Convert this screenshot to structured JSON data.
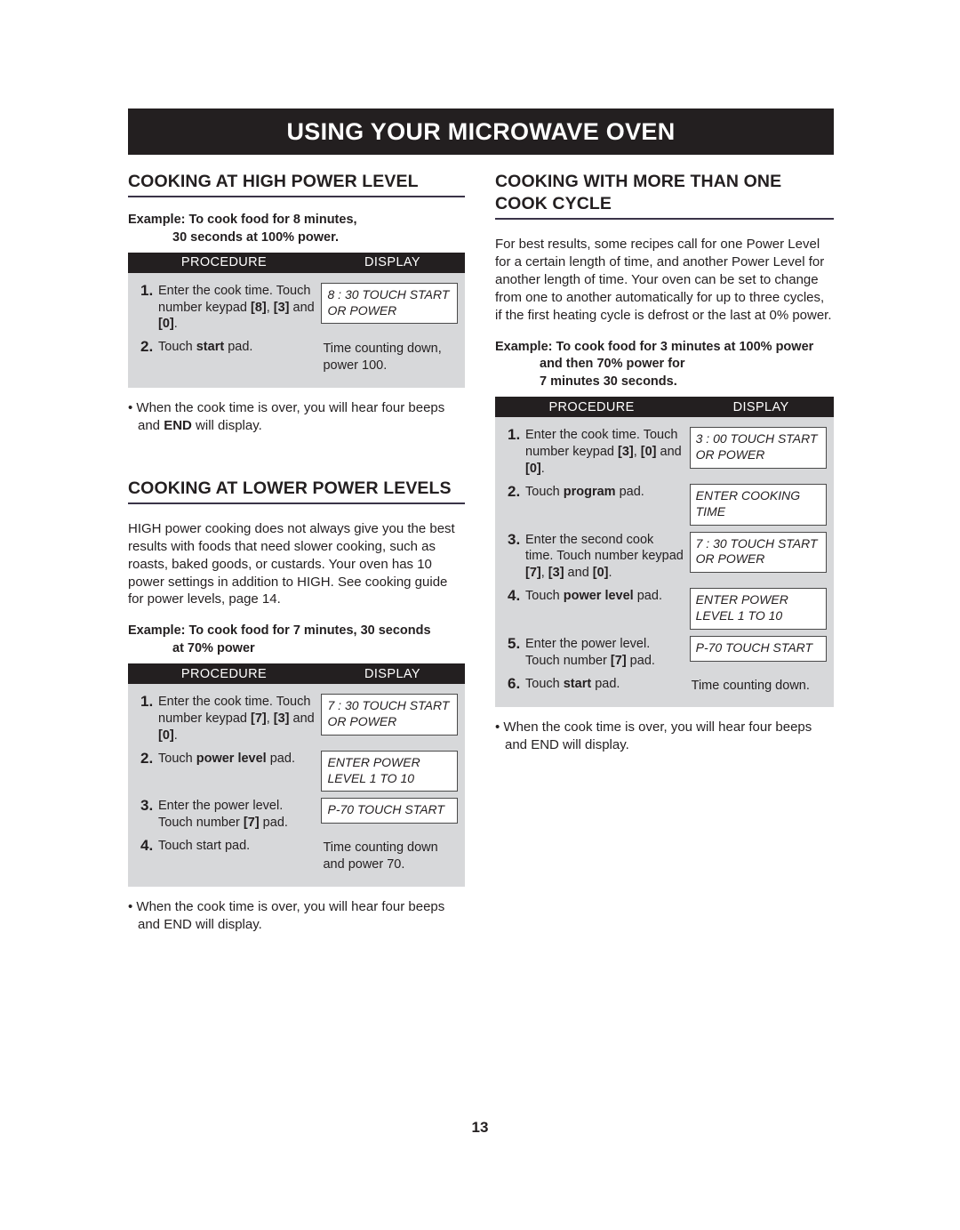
{
  "banner": {
    "title": "USING YOUR MICROWAVE OVEN"
  },
  "page_number": "13",
  "left_column": {
    "section1": {
      "heading": "COOKING AT HIGH POWER LEVEL",
      "example_line1": "Example: To cook food for 8 minutes,",
      "example_line2": "30 seconds at 100% power.",
      "table": {
        "header_procedure": "PROCEDURE",
        "header_display": "DISPLAY",
        "rows": [
          {
            "num": "1.",
            "procedure_parts": [
              {
                "text": "Enter the cook time. Touch number keypad ",
                "bold": false
              },
              {
                "text": "[8]",
                "bold": true
              },
              {
                "text": ", ",
                "bold": false
              },
              {
                "text": "[3]",
                "bold": true
              },
              {
                "text": " and ",
                "bold": false
              },
              {
                "text": "[0]",
                "bold": true
              },
              {
                "text": ".",
                "bold": false
              }
            ],
            "display": "8 : 30 TOUCH START OR POWER",
            "display_boxed": true
          },
          {
            "num": "2.",
            "procedure_parts": [
              {
                "text": "Touch ",
                "bold": false
              },
              {
                "text": "start",
                "bold": true
              },
              {
                "text": " pad.",
                "bold": false
              }
            ],
            "display": "Time counting down, power 100.",
            "display_boxed": false
          }
        ]
      },
      "note_parts": [
        {
          "text": "• When the cook time is over, you will hear four beeps and ",
          "bold": false
        },
        {
          "text": "END",
          "bold": true
        },
        {
          "text": " will display.",
          "bold": false
        }
      ]
    },
    "section2": {
      "heading": "COOKING AT LOWER POWER LEVELS",
      "body": "HIGH power cooking does not always give you the best results with foods that need slower cooking, such as roasts, baked goods, or custards. Your oven has 10 power settings in addition to HIGH. See cooking guide for power levels, page 14.",
      "example_line1": "Example: To cook food for 7 minutes, 30 seconds",
      "example_line2": "at 70% power",
      "table": {
        "header_procedure": "PROCEDURE",
        "header_display": "DISPLAY",
        "rows": [
          {
            "num": "1.",
            "procedure_parts": [
              {
                "text": "Enter the cook time. Touch number keypad ",
                "bold": false
              },
              {
                "text": "[7]",
                "bold": true
              },
              {
                "text": ", ",
                "bold": false
              },
              {
                "text": "[3]",
                "bold": true
              },
              {
                "text": " and ",
                "bold": false
              },
              {
                "text": "[0]",
                "bold": true
              },
              {
                "text": ".",
                "bold": false
              }
            ],
            "display": "7 : 30 TOUCH START OR POWER",
            "display_boxed": true
          },
          {
            "num": "2.",
            "procedure_parts": [
              {
                "text": "Touch ",
                "bold": false
              },
              {
                "text": "power level",
                "bold": true
              },
              {
                "text": " pad.",
                "bold": false
              }
            ],
            "display": "ENTER POWER LEVEL 1 TO 10",
            "display_boxed": true
          },
          {
            "num": "3.",
            "procedure_parts": [
              {
                "text": "Enter the power level. Touch number ",
                "bold": false
              },
              {
                "text": "[7]",
                "bold": true
              },
              {
                "text": " pad.",
                "bold": false
              }
            ],
            "display": "P-70 TOUCH START",
            "display_boxed": true
          },
          {
            "num": "4.",
            "procedure_parts": [
              {
                "text": "Touch start pad.",
                "bold": false
              }
            ],
            "display": "Time counting down and power 70.",
            "display_boxed": false
          }
        ]
      },
      "note_parts": [
        {
          "text": "• When the cook time is over, you will hear four beeps and END will display.",
          "bold": false
        }
      ]
    }
  },
  "right_column": {
    "section1": {
      "heading": "COOKING WITH MORE THAN ONE COOK CYCLE",
      "body": "For best results, some recipes call for one Power Level for a certain length of time, and another Power Level for another length of time. Your oven can be set to change from one to another automatically for up to three cycles, if the first heating cycle is defrost or the last at 0% power.",
      "example_line1": "Example: To cook food for 3 minutes at 100% power",
      "example_line2": "and then 70% power for",
      "example_line3": "7 minutes 30 seconds.",
      "table": {
        "header_procedure": "PROCEDURE",
        "header_display": "DISPLAY",
        "rows": [
          {
            "num": "1.",
            "procedure_parts": [
              {
                "text": "Enter the cook time. Touch number keypad ",
                "bold": false
              },
              {
                "text": "[3]",
                "bold": true
              },
              {
                "text": ", ",
                "bold": false
              },
              {
                "text": "[0]",
                "bold": true
              },
              {
                "text": " and ",
                "bold": false
              },
              {
                "text": "[0]",
                "bold": true
              },
              {
                "text": ".",
                "bold": false
              }
            ],
            "display": "3 : 00 TOUCH START OR POWER",
            "display_boxed": true
          },
          {
            "num": "2.",
            "procedure_parts": [
              {
                "text": "Touch ",
                "bold": false
              },
              {
                "text": "program",
                "bold": true
              },
              {
                "text": " pad.",
                "bold": false
              }
            ],
            "display": "ENTER COOKING TIME",
            "display_boxed": true
          },
          {
            "num": "3.",
            "procedure_parts": [
              {
                "text": "Enter the second cook time. Touch number keypad ",
                "bold": false
              },
              {
                "text": "[7]",
                "bold": true
              },
              {
                "text": ", ",
                "bold": false
              },
              {
                "text": "[3]",
                "bold": true
              },
              {
                "text": " and ",
                "bold": false
              },
              {
                "text": "[0]",
                "bold": true
              },
              {
                "text": ".",
                "bold": false
              }
            ],
            "display": "7 : 30 TOUCH START OR POWER",
            "display_boxed": true
          },
          {
            "num": "4.",
            "procedure_parts": [
              {
                "text": "Touch ",
                "bold": false
              },
              {
                "text": "power level",
                "bold": true
              },
              {
                "text": " pad.",
                "bold": false
              }
            ],
            "display": "ENTER POWER LEVEL 1 TO 10",
            "display_boxed": true
          },
          {
            "num": "5.",
            "procedure_parts": [
              {
                "text": "Enter the power level. Touch number ",
                "bold": false
              },
              {
                "text": "[7]",
                "bold": true
              },
              {
                "text": " pad.",
                "bold": false
              }
            ],
            "display": "P-70 TOUCH START",
            "display_boxed": true
          },
          {
            "num": "6.",
            "procedure_parts": [
              {
                "text": "Touch ",
                "bold": false
              },
              {
                "text": "start",
                "bold": true
              },
              {
                "text": " pad.",
                "bold": false
              }
            ],
            "display": "Time counting down.",
            "display_boxed": false
          }
        ]
      },
      "note_parts": [
        {
          "text": "• When the cook time is over, you will hear four beeps and END will display.",
          "bold": false
        }
      ]
    }
  },
  "colors": {
    "banner_bg": "#231f20",
    "table_header_bg": "#231f20",
    "table_body_bg": "#d7d8da",
    "rule": "#3a3348",
    "text": "#231f20"
  }
}
